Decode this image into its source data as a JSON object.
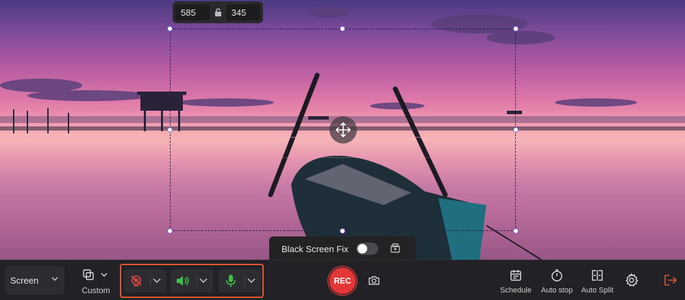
{
  "selection": {
    "width_value": "585",
    "height_value": "345"
  },
  "black_screen_fix": {
    "label": "Black Screen Fix",
    "enabled": false
  },
  "toolbar": {
    "capture_mode": "Screen",
    "region_label": "Custom",
    "record_button": "REC",
    "schedule_label": "Schedule",
    "auto_stop_label": "Auto stop",
    "auto_split_label": "Auto Split"
  },
  "sources": {
    "webcam_icon": "webcam-off-icon",
    "speaker_icon": "speaker-icon",
    "microphone_icon": "microphone-icon"
  },
  "colors": {
    "accent_purple": "#7a5bd6",
    "record_red": "#e4373a",
    "highlight_orange": "#e4572e",
    "audio_green": "#3ec24a"
  }
}
